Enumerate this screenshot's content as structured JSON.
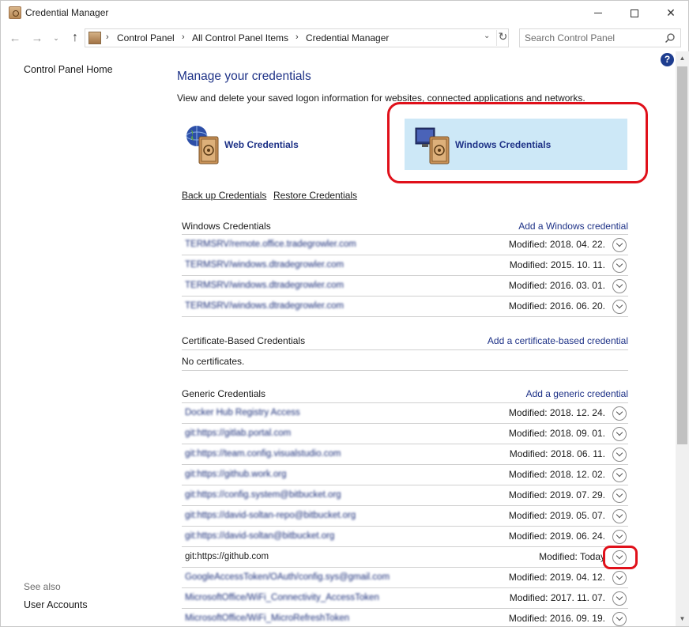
{
  "window": {
    "title": "Credential Manager",
    "min_glyph": "—",
    "close_glyph": "✕"
  },
  "address": {
    "back_glyph": "←",
    "forward_glyph": "→",
    "dropdown_glyph": "⌄",
    "up_glyph": "↑",
    "sep_glyph": "›",
    "breadcrumbs": [
      "Control Panel",
      "All Control Panel Items",
      "Credential Manager"
    ],
    "dropdown_arrow": "⌄",
    "refresh_glyph": "↻",
    "search_placeholder": "Search Control Panel"
  },
  "help_glyph": "?",
  "left_pane": {
    "home_link": "Control Panel Home",
    "see_also_label": "See also",
    "see_also_links": [
      "User Accounts"
    ]
  },
  "main": {
    "title": "Manage your credentials",
    "description": "View and delete your saved logon information for websites, connected applications and networks.",
    "tiles": {
      "web": "Web Credentials",
      "windows": "Windows Credentials"
    },
    "actions": {
      "backup": "Back up Credentials",
      "restore": "Restore Credentials"
    },
    "windows_section": {
      "title": "Windows Credentials",
      "add_link": "Add a Windows credential",
      "rows": [
        {
          "name": "TERMSRV/remote.office.tradegrowler.com",
          "modified": "Modified:  2018. 04. 22."
        },
        {
          "name": "TERMSRV/windows.dtradegrowler.com",
          "modified": "Modified:  2015. 10. 11."
        },
        {
          "name": "TERMSRV/windows.dtradegrowler.com",
          "modified": "Modified:  2016. 03. 01."
        },
        {
          "name": "TERMSRV/windows.dtradegrowler.com",
          "modified": "Modified:  2016. 06. 20."
        }
      ]
    },
    "certificate_section": {
      "title": "Certificate-Based Credentials",
      "add_link": "Add a certificate-based credential",
      "empty_text": "No certificates."
    },
    "generic_section": {
      "title": "Generic Credentials",
      "add_link": "Add a generic credential",
      "rows": [
        {
          "name": "Docker Hub Registry Access",
          "modified": "Modified:  2018. 12. 24.",
          "blurred": true
        },
        {
          "name": "git:https://gitlab.portal.com",
          "modified": "Modified:  2018. 09. 01.",
          "blurred": true
        },
        {
          "name": "git:https://team.config.visualstudio.com",
          "modified": "Modified:  2018. 06. 11.",
          "blurred": true
        },
        {
          "name": "git:https://github.work.org",
          "modified": "Modified:  2018. 12. 02.",
          "blurred": true
        },
        {
          "name": "git:https://config.system@bitbucket.org",
          "modified": "Modified:  2019. 07. 29.",
          "blurred": true
        },
        {
          "name": "git:https://david-soltan-repo@bitbucket.org",
          "modified": "Modified:  2019. 05. 07.",
          "blurred": true
        },
        {
          "name": "git:https://david-soltan@bitbucket.org",
          "modified": "Modified:  2019. 06. 24.",
          "blurred": true
        },
        {
          "name": "git:https://github.com",
          "modified": "Modified:  Today",
          "blurred": false
        },
        {
          "name": "GoogleAccessToken/OAuth/config.sys@gmail.com",
          "modified": "Modified:  2019. 04. 12.",
          "blurred": true
        },
        {
          "name": "MicrosoftOffice/WiFi_Connectivity_AccessToken",
          "modified": "Modified:  2017. 11. 07.",
          "blurred": true
        },
        {
          "name": "MicrosoftOffice/WiFi_MicroRefreshToken",
          "modified": "Modified:  2016. 09. 19.",
          "blurred": true
        }
      ]
    }
  },
  "scrollbar": {
    "up_glyph": "▲",
    "down_glyph": "▼"
  }
}
